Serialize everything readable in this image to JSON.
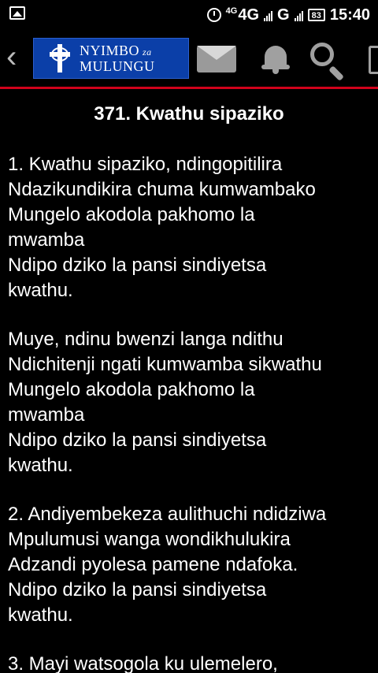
{
  "status_bar": {
    "network_small": "4G",
    "network_large": "4G",
    "network_secondary": "G",
    "battery": "83",
    "time": "15:40"
  },
  "toolbar": {
    "logo_line1": "NYIMBO",
    "logo_za": "za",
    "logo_line2": "MULUNGU",
    "accent_color": "#d0021b",
    "logo_bg": "#0b3fa8"
  },
  "hymn": {
    "title": "371. Kwathu sipaziko",
    "verses": [
      {
        "lines": [
          "1. Kwathu sipaziko, ndingopitilira",
          "Ndazikundikira chuma kumwambako",
          "Mungelo akodola pakhomo la",
          "mwamba",
          "Ndipo dziko la pansi sindiyetsa",
          "kwathu."
        ]
      },
      {
        "lines": [
          "Muye, ndinu bwenzi langa ndithu",
          "Ndichitenji ngati kumwamba sikwathu",
          "Mungelo akodola pakhomo la",
          "mwamba",
          "Ndipo dziko la pansi sindiyetsa",
          "kwathu."
        ]
      },
      {
        "lines": [
          "2. Andiyembekeza aulithuchi ndidziwa",
          "Mpulumusi wanga wondikhulukira",
          "Adzandi pyolesa pamene ndafoka.",
          "Ndipo dziko la pansi sindiyetsa",
          "kwathu."
        ]
      },
      {
        "lines": [
          "3. Mayi watsogola ku ulemelero,"
        ]
      }
    ]
  }
}
